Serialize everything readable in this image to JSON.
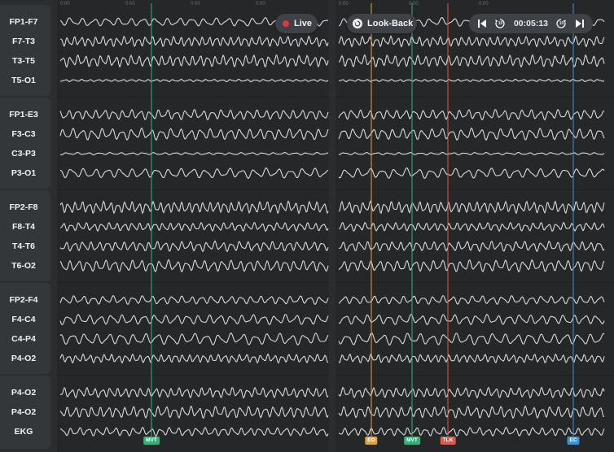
{
  "controls": {
    "live_label": "Live",
    "lookback_label": "Look-Back",
    "time_display": "00:05:13",
    "skip_back_seconds": "10",
    "skip_forward_seconds": "10",
    "colors": {
      "live_dot": "#e0353b"
    }
  },
  "tick_labels": [
    "0:00",
    "0:00",
    "0:00",
    "0:00",
    "0:00",
    "0:00",
    "0:00"
  ],
  "groups": [
    {
      "channels": [
        "FP1-F7",
        "F7-T3",
        "T3-T5",
        "T5-O1"
      ]
    },
    {
      "channels": [
        "FP1-E3",
        "F3-C3",
        "C3-P3",
        "P3-O1"
      ]
    },
    {
      "channels": [
        "FP2-F8",
        "F8-T4",
        "T4-T6",
        "T6-O2"
      ]
    },
    {
      "channels": [
        "FP2-F4",
        "F4-C4",
        "C4-P4",
        "P4-O2"
      ]
    },
    {
      "channels": [
        "P4-O2",
        "P4-O2",
        "EKG"
      ]
    }
  ],
  "markers": [
    {
      "label": "MVT",
      "color": "#2fb37a",
      "panel": "left"
    },
    {
      "label": "EO",
      "color": "#e0a33a",
      "panel": "right"
    },
    {
      "label": "MVT",
      "color": "#2fb37a",
      "panel": "right"
    },
    {
      "label": "TLK",
      "color": "#e2574c",
      "panel": "right"
    },
    {
      "label": "EC",
      "color": "#3a92d8",
      "panel": "right"
    }
  ],
  "trace_color": "#d9dbde"
}
